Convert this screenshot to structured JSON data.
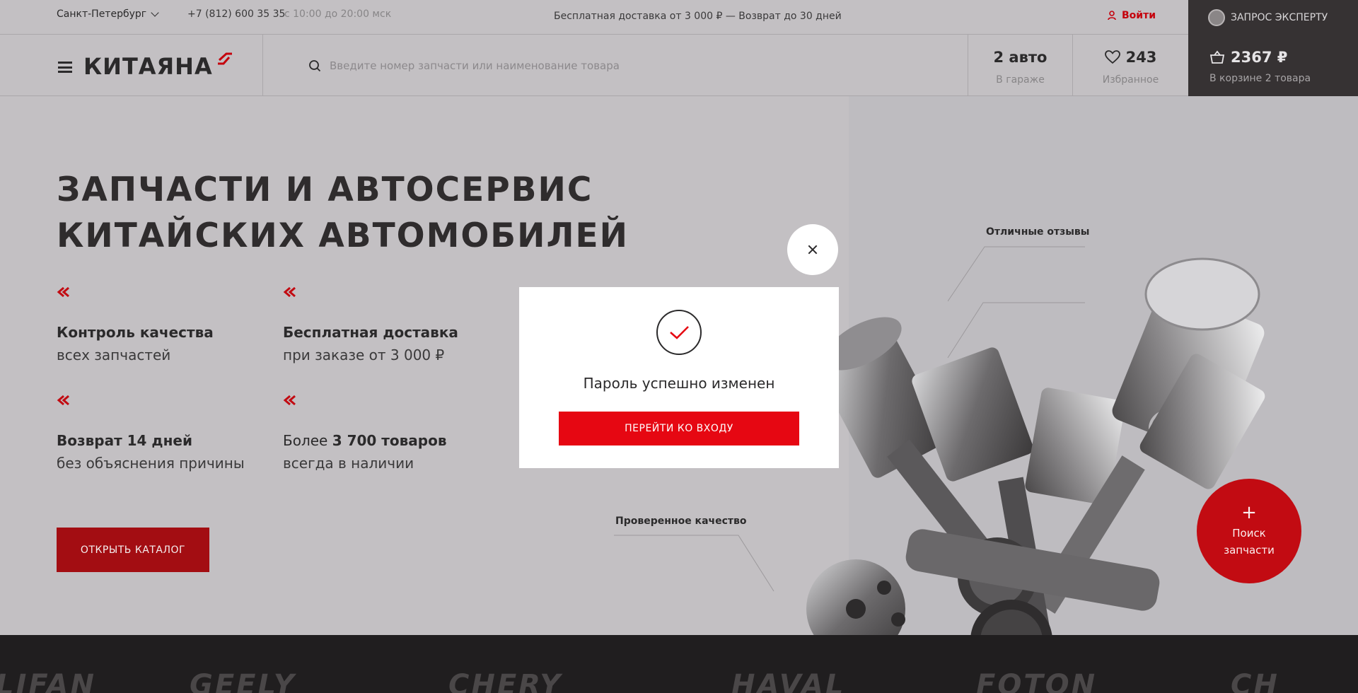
{
  "topbar": {
    "city": "Санкт-Петербург",
    "phone": "+7 (812) 600 35 35",
    "hours": "с 10:00 до 20:00 мск",
    "delivery": "Бесплатная доставка от 3 000 ₽ — Возврат до 30 дней",
    "login": "Войти",
    "expert": "ЗАПРОС ЭКСПЕРТУ"
  },
  "header": {
    "logo": "КИТАЯНА",
    "search_placeholder": "Введите номер запчасти или наименование товара",
    "garage_value": "2 авто",
    "garage_label": "В гараже",
    "fav_value": "243",
    "fav_label": "Избранное",
    "cart_value": "2367 ₽",
    "cart_label": "В корзине 2 товара"
  },
  "hero": {
    "title_line1": "ЗАПЧАСТИ И АВТОСЕРВИС",
    "title_line2": "КИТАЙСКИХ АВТОМОБИЛЕЙ",
    "features": [
      {
        "t1": "Контроль качества",
        "t2": "всех запчастей"
      },
      {
        "t1": "Бесплатная доставка",
        "t2": "при заказе от 3 000 ₽"
      },
      {
        "t1": "Возврат 14 дней",
        "t2": "без объяснения причины"
      },
      {
        "t1_pre": "Более ",
        "t1": "3 700 товаров",
        "t2": "всегда в наличии"
      }
    ],
    "catalog_button": "ОТКРЫТЬ КАТАЛОГ",
    "callout_reviews": "Отличные отзывы",
    "callout_quality": "Проверенное качество",
    "search_parts_plus": "+",
    "search_parts_line1": "Поиск",
    "search_parts_line2": "запчасти"
  },
  "brands": [
    "LIFAN",
    "GEELY",
    "CHERY",
    "HAVAL",
    "FOTON",
    "CH"
  ],
  "modal": {
    "title": "Пароль успешно изменен",
    "button": "ПЕРЕЙТИ КО ВХОДУ"
  },
  "colors": {
    "accent_red": "#e60712",
    "dark_red": "#a30d12",
    "dark_panel": "#363233"
  }
}
